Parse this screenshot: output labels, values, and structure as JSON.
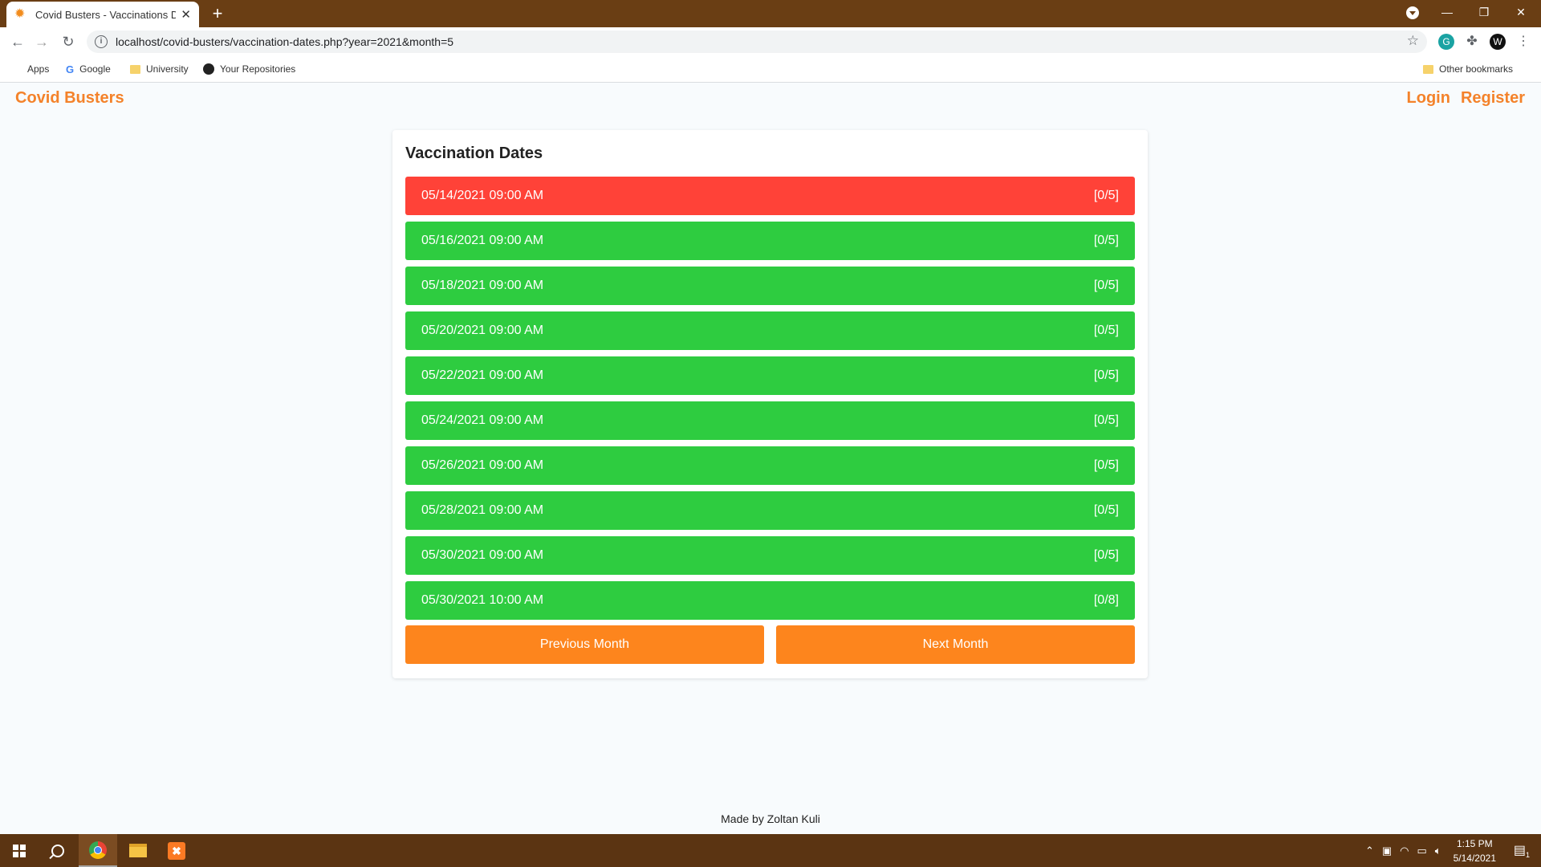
{
  "browser": {
    "tab_title": "Covid Busters - Vaccinations Dates",
    "tab_favicon": "virus-icon",
    "url": "localhost/covid-busters/vaccination-dates.php?year=2021&month=5",
    "bookmarks": [
      "Apps",
      "Google",
      "University",
      "Your Repositories"
    ],
    "other_bookmarks": "Other bookmarks"
  },
  "header": {
    "brand": "Covid Busters",
    "login": "Login",
    "register": "Register"
  },
  "card": {
    "title": "Vaccination Dates",
    "slots": [
      {
        "datetime": "05/14/2021 09:00 AM",
        "capacity": "[0/5]",
        "status": "full"
      },
      {
        "datetime": "05/16/2021 09:00 AM",
        "capacity": "[0/5]",
        "status": "open"
      },
      {
        "datetime": "05/18/2021 09:00 AM",
        "capacity": "[0/5]",
        "status": "open"
      },
      {
        "datetime": "05/20/2021 09:00 AM",
        "capacity": "[0/5]",
        "status": "open"
      },
      {
        "datetime": "05/22/2021 09:00 AM",
        "capacity": "[0/5]",
        "status": "open"
      },
      {
        "datetime": "05/24/2021 09:00 AM",
        "capacity": "[0/5]",
        "status": "open"
      },
      {
        "datetime": "05/26/2021 09:00 AM",
        "capacity": "[0/5]",
        "status": "open"
      },
      {
        "datetime": "05/28/2021 09:00 AM",
        "capacity": "[0/5]",
        "status": "open"
      },
      {
        "datetime": "05/30/2021 09:00 AM",
        "capacity": "[0/5]",
        "status": "open"
      },
      {
        "datetime": "05/30/2021 10:00 AM",
        "capacity": "[0/8]",
        "status": "open"
      }
    ],
    "prev_month": "Previous Month",
    "next_month": "Next Month"
  },
  "footer": "Made by Zoltan Kuli",
  "colors": {
    "brand": "#f4822a",
    "slot_full": "#ff4238",
    "slot_open": "#2ecc40",
    "month_button": "#fd851d"
  },
  "taskbar": {
    "time": "1:15 PM",
    "date": "5/14/2021",
    "notification_count": "1"
  }
}
